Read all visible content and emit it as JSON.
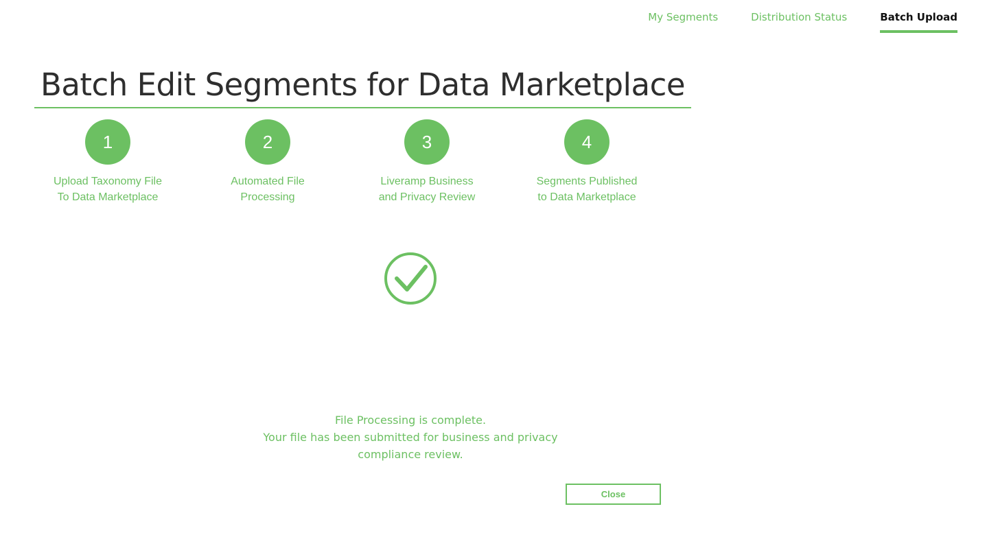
{
  "nav": {
    "items": [
      {
        "label": "My Segments",
        "active": false
      },
      {
        "label": "Distribution Status",
        "active": false
      },
      {
        "label": "Batch Upload",
        "active": true
      }
    ]
  },
  "page": {
    "title": "Batch Edit Segments for Data Marketplace"
  },
  "steps": [
    {
      "number": "1",
      "label_line1": "Upload Taxonomy File",
      "label_line2": "To Data Marketplace"
    },
    {
      "number": "2",
      "label_line1": "Automated File",
      "label_line2": "Processing"
    },
    {
      "number": "3",
      "label_line1": "Liveramp Business",
      "label_line2": "and Privacy Review"
    },
    {
      "number": "4",
      "label_line1": "Segments Published",
      "label_line2": "to Data Marketplace"
    }
  ],
  "status": {
    "icon": "check-circle-icon",
    "line1": "File Processing is complete.",
    "line2": "Your file has been submitted for business and privacy",
    "line3": "compliance review."
  },
  "actions": {
    "close_label": "Close"
  },
  "colors": {
    "accent": "#6cc062",
    "title": "#2e2e2e",
    "nav_active": "#111111"
  }
}
